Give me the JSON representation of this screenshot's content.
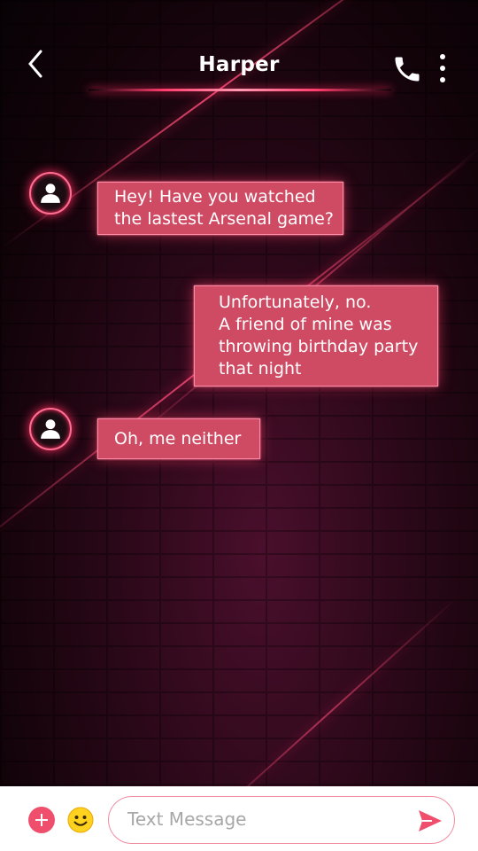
{
  "header": {
    "contact_name": "Harper",
    "back_icon": "chevron-left-icon",
    "call_icon": "phone-icon",
    "more_icon": "more-vertical-icon"
  },
  "messages": [
    {
      "direction": "incoming",
      "text": "Hey! Have you watched\nthe lastest Arsenal game?"
    },
    {
      "direction": "outgoing",
      "text": "Unfortunately, no.\nA friend of mine was\nthrowing birthday party\nthat night"
    },
    {
      "direction": "incoming",
      "text": "Oh, me neither"
    }
  ],
  "composer": {
    "placeholder": "Text Message",
    "add_icon": "plus-icon",
    "emoji_icon": "smiley-icon",
    "send_icon": "send-icon"
  },
  "colors": {
    "accent": "#ef4f6d",
    "bubble": "#cf4b64",
    "glow": "#ff2d62"
  }
}
